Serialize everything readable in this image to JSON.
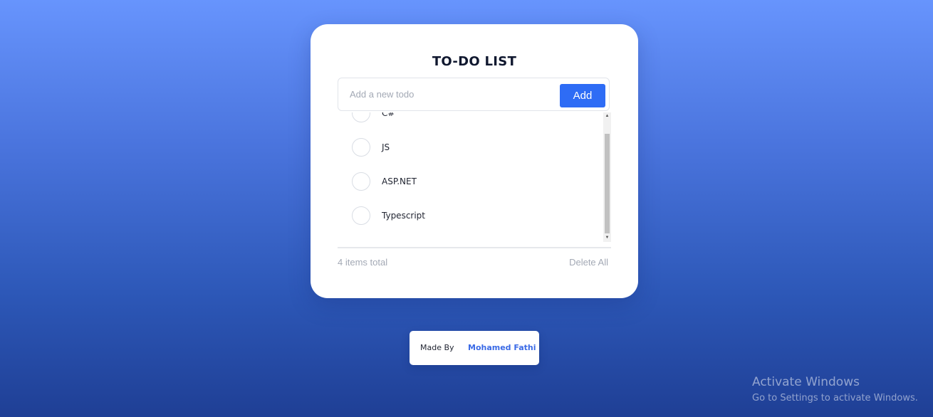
{
  "app": {
    "title": "TO-DO LIST"
  },
  "input": {
    "placeholder": "Add a new todo",
    "value": "",
    "add_label": "Add"
  },
  "todos": [
    {
      "text": "C#",
      "done": false
    },
    {
      "text": "JS",
      "done": false
    },
    {
      "text": "ASP.NET",
      "done": false
    },
    {
      "text": "Typescript",
      "done": false
    }
  ],
  "footer": {
    "total_label": "4 items total",
    "delete_all_label": "Delete All"
  },
  "credit": {
    "label": "Made By",
    "name": "Mohamed Fathi"
  },
  "watermark": {
    "title": "Activate Windows",
    "subtitle": "Go to Settings to activate Windows."
  },
  "icons": {
    "scroll_up": "triangle-up",
    "scroll_down": "triangle-down"
  },
  "colors": {
    "accent": "#2e6cf5",
    "credit_name": "#3a6ae6",
    "muted_text": "#a3a9b5",
    "background_top": "#6794fd",
    "background_bottom": "#1f3f95"
  }
}
